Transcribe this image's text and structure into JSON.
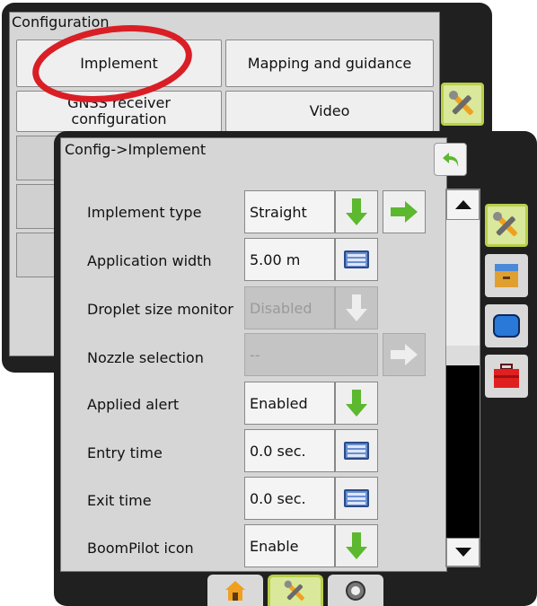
{
  "config_panel": {
    "title": "Configuration",
    "buttons": [
      {
        "label": "Implement"
      },
      {
        "label": "Mapping and guidance"
      },
      {
        "label": "GNSS receiver configuration"
      },
      {
        "label": "Video"
      }
    ]
  },
  "implement_panel": {
    "title": "Config->Implement",
    "rows": [
      {
        "label": "Implement type",
        "value": "Straight"
      },
      {
        "label": "Application width",
        "value": "5.00 m"
      },
      {
        "label": "Droplet size monitor",
        "value": "Disabled"
      },
      {
        "label": "Nozzle selection",
        "value": "--"
      },
      {
        "label": "Applied alert",
        "value": "Enabled"
      },
      {
        "label": "Entry time",
        "value": "0.0 sec."
      },
      {
        "label": "Exit time",
        "value": "0.0 sec."
      },
      {
        "label": "BoomPilot icon",
        "value": "Enable"
      }
    ]
  },
  "side_tabs": [
    "tools-icon",
    "filing-cabinet-icon",
    "screen-icon",
    "toolbox-icon"
  ],
  "bottom_tabs": [
    "home-icon",
    "tools-icon",
    "gauge-icon"
  ],
  "colors": {
    "accent_green": "#5cb82e",
    "highlight": "#c8e060",
    "annotation_red": "#d91e26"
  }
}
